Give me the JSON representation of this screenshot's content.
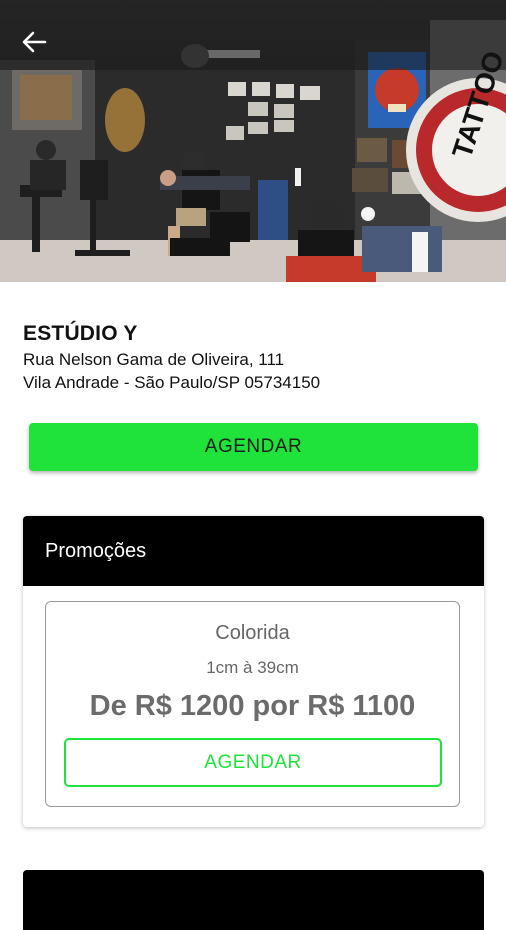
{
  "studio": {
    "name": "ESTÚDIO Y",
    "address_line1": "Rua Nelson Gama de Oliveira, 111",
    "address_line2": "Vila Andrade - São Paulo/SP 05734150",
    "hero_sign_text": "TATTOO"
  },
  "actions": {
    "book_label": "AGENDAR"
  },
  "promotions": {
    "title": "Promoções",
    "items": [
      {
        "name": "Colorida",
        "size": "1cm à 39cm",
        "price_text": "De R$ 1200 por R$ 1100",
        "button_label": "AGENDAR"
      }
    ]
  },
  "colors": {
    "accent": "#1fe33b",
    "header_bg": "#000000"
  },
  "icons": {
    "back": "arrow-left-icon"
  }
}
